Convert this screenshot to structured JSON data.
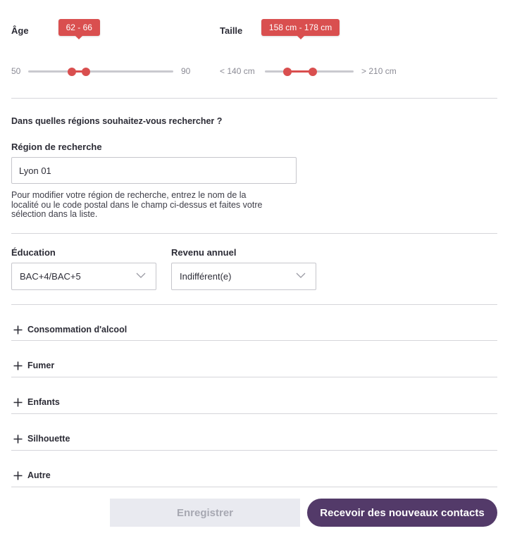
{
  "age": {
    "label": "Âge",
    "min_label": "50",
    "max_label": "90",
    "range_min": 50,
    "range_max": 90,
    "selected_low": 62,
    "selected_high": 66,
    "tooltip": "62 - 66"
  },
  "height": {
    "label": "Taille",
    "min_label": "< 140 cm",
    "max_label": "> 210 cm",
    "range_min": 140,
    "range_max": 210,
    "selected_low": 158,
    "selected_high": 178,
    "tooltip": "158 cm - 178 cm"
  },
  "region": {
    "question": "Dans quelles régions souhaitez-vous rechercher ?",
    "label": "Région de recherche",
    "value": "Lyon 01",
    "help_line1": "Pour modifier votre région de recherche, entrez le nom de la",
    "help_line2": "localité ou le code postal dans le champ ci-dessus et faites votre",
    "help_line3": "sélection dans la liste."
  },
  "education": {
    "label": "Éducation",
    "selected": "BAC+4/BAC+5"
  },
  "income": {
    "label": "Revenu annuel",
    "selected": "Indifférent(e)"
  },
  "accordion": [
    {
      "label": "Consommation d'alcool"
    },
    {
      "label": "Fumer"
    },
    {
      "label": "Enfants"
    },
    {
      "label": "Silhouette"
    },
    {
      "label": "Autre"
    }
  ],
  "buttons": {
    "save": "Enregistrer",
    "primary": "Recevoir des nouveaux contacts"
  },
  "colors": {
    "accent_red": "#d94f4f",
    "primary_purple": "#533a69",
    "disabled_bg": "#e9eaf0",
    "divider": "#d5d5da"
  },
  "icons": {
    "expand": "plus-icon",
    "dropdown": "chevron-down-icon"
  }
}
